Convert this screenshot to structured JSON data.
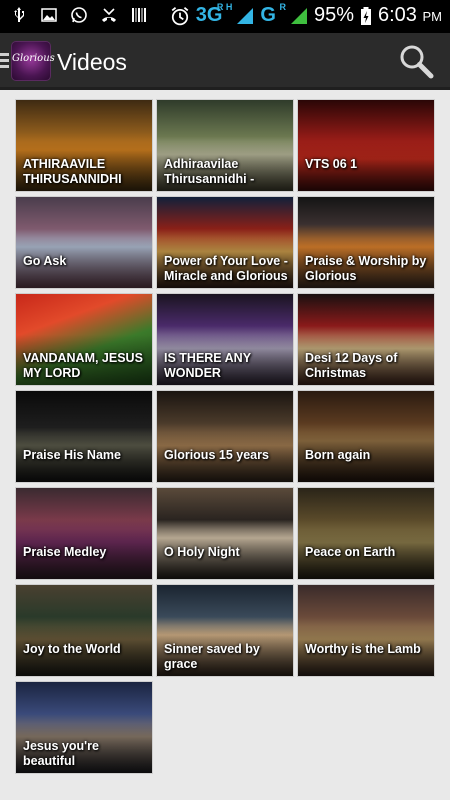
{
  "status_bar": {
    "network_type": "3G",
    "network_sub_1": "R H",
    "network_type_2": "G",
    "network_sub_2": "R",
    "battery": "95%",
    "time": "6:03",
    "time_suffix": "PM"
  },
  "action_bar": {
    "app_logo_text": "Glorious",
    "title": "Videos"
  },
  "videos": [
    {
      "title": "ATHIRAAVILE THIRUSANNIDHI",
      "bg": "linear-gradient(180deg,#3e2a12 0%,#8b5a1c 35%,#c77a1e 55%,#3a2a10 100%)"
    },
    {
      "title": "Adhiraavilae Thirusannidhi -",
      "bg": "linear-gradient(180deg,#2f3b2a 0%,#6b7850 40%,#b8b89a 60%,#3c3a2a 100%)"
    },
    {
      "title": "VTS 06 1",
      "bg": "linear-gradient(180deg,#2a0606 0%,#8e1a16 40%,#c32a1c 65%,#3a0b0a 100%)"
    },
    {
      "title": "Go Ask",
      "bg": "linear-gradient(180deg,#4a3d4c 0%,#7f5a6e 35%,#a8b4c8 55%,#5d3a48 100%)"
    },
    {
      "title": "Power of Your Love - Miracle and Glorious",
      "bg": "linear-gradient(180deg,#12203a 0%,#8a2018 35%,#c89a4a 60%,#2b1a16 100%)"
    },
    {
      "title": "Praise & Worship by Glorious",
      "bg": "linear-gradient(180deg,#141414 0%,#3a3030 30%,#d07a2a 55%,#3a2a20 100%)"
    },
    {
      "title": "VANDANAM, JESUS MY LORD",
      "bg": "linear-gradient(160deg,#c8281a 0%,#e24a2a 30%,#3b7a2a 60%,#1e4a18 100%)"
    },
    {
      "title": "IS THERE ANY WONDER",
      "bg": "linear-gradient(180deg,#1a1420 0%,#4a2a6a 35%,#a8a0b8 60%,#2a2230 100%)"
    },
    {
      "title": "Desi 12 Days of Christmas",
      "bg": "linear-gradient(180deg,#1a1010 0%,#8a1a1a 35%,#c8b080 60%,#3a2018 100%)"
    },
    {
      "title": "Praise His Name",
      "bg": "linear-gradient(180deg,#0a0a0a 0%,#1e1e1e 40%,#5a5a4a 60%,#101010 100%)"
    },
    {
      "title": "Glorious 15 years",
      "bg": "linear-gradient(180deg,#1a1410 0%,#4a3a2a 35%,#a07a50 60%,#2a2018 100%)"
    },
    {
      "title": "Born again",
      "bg": "linear-gradient(180deg,#2a1a10 0%,#5a3a20 35%,#8a6a40 55%,#1e120c 100%)"
    },
    {
      "title": "Praise Medley",
      "bg": "linear-gradient(180deg,#3a2a30 0%,#7a3a4a 35%,#6a2a5a 60%,#2a1a22 100%)"
    },
    {
      "title": "O Holy Night",
      "bg": "linear-gradient(180deg,#5a4a3a 0%,#2a2420 35%,#c8b8a0 55%,#1e1a16 100%)"
    },
    {
      "title": "Peace on Earth",
      "bg": "linear-gradient(180deg,#2a2418 0%,#5a4a2a 35%,#8a7a4a 60%,#1e1a10 100%)"
    },
    {
      "title": "Joy to the World",
      "bg": "linear-gradient(180deg,#4a4030 0%,#2a3a2a 35%,#6a5a3a 60%,#1a1a14 100%)"
    },
    {
      "title": "Sinner saved by grace",
      "bg": "linear-gradient(180deg,#1a2430 0%,#3a4a5a 35%,#c8a880 55%,#2a2018 100%)"
    },
    {
      "title": "Worthy is the Lamb",
      "bg": "linear-gradient(180deg,#3a2a2a 0%,#6a4a3a 35%,#a88a5a 60%,#2a1e18 100%)"
    },
    {
      "title": "Jesus you're beautiful",
      "bg": "linear-gradient(180deg,#1a2440 0%,#3a4a7a 35%,#8a7a6a 60%,#1a1a1e 100%)"
    }
  ]
}
